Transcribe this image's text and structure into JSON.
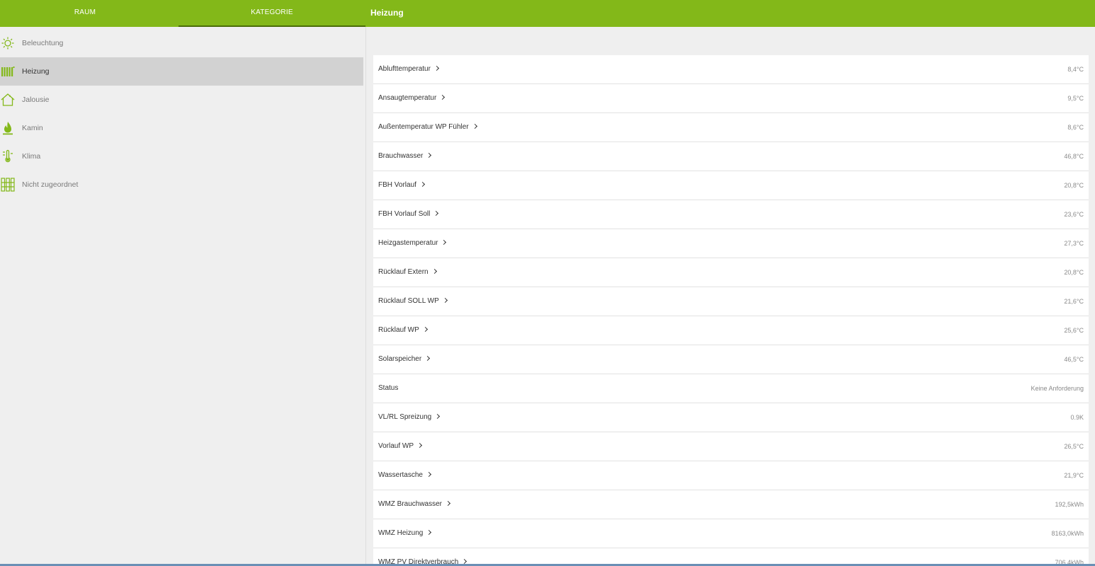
{
  "header": {
    "tabs": [
      {
        "label": "RAUM"
      },
      {
        "label": "KATEGORIE"
      }
    ],
    "title": "Heizung",
    "accent_color": "#83b819"
  },
  "sidebar": {
    "items": [
      {
        "label": "Beleuchtung",
        "icon": "lightbulb-icon"
      },
      {
        "label": "Heizung",
        "icon": "radiator-icon",
        "active": true
      },
      {
        "label": "Jalousie",
        "icon": "house-icon"
      },
      {
        "label": "Kamin",
        "icon": "flame-icon"
      },
      {
        "label": "Klima",
        "icon": "thermometer-icon"
      },
      {
        "label": "Nicht zugeordnet",
        "icon": "grid-icon"
      }
    ]
  },
  "list": {
    "rows": [
      {
        "name": "Ablufttemperatur",
        "value": "8,4°C",
        "chevron": true
      },
      {
        "name": "Ansaugtemperatur",
        "value": "9,5°C",
        "chevron": true
      },
      {
        "name": "Außentemperatur WP Fühler",
        "value": "8,6°C",
        "chevron": true
      },
      {
        "name": "Brauchwasser",
        "value": "46,8°C",
        "chevron": true
      },
      {
        "name": "FBH Vorlauf",
        "value": "20,8°C",
        "chevron": true
      },
      {
        "name": "FBH Vorlauf Soll",
        "value": "23,6°C",
        "chevron": true
      },
      {
        "name": "Heizgastemperatur",
        "value": "27,3°C",
        "chevron": true
      },
      {
        "name": "Rücklauf Extern",
        "value": "20,8°C",
        "chevron": true
      },
      {
        "name": "Rücklauf SOLL WP",
        "value": "21,6°C",
        "chevron": true
      },
      {
        "name": "Rücklauf WP",
        "value": "25,6°C",
        "chevron": true
      },
      {
        "name": "Solarspeicher",
        "value": "46,5°C",
        "chevron": true
      },
      {
        "name": "Status",
        "value": "Keine Anforderung",
        "chevron": false
      },
      {
        "name": "VL/RL Spreizung",
        "value": "0.9K",
        "chevron": true
      },
      {
        "name": "Vorlauf WP",
        "value": "26,5°C",
        "chevron": true
      },
      {
        "name": "Wassertasche",
        "value": "21,9°C",
        "chevron": true
      },
      {
        "name": "WMZ Brauchwasser",
        "value": "192,5kWh",
        "chevron": true
      },
      {
        "name": "WMZ Heizung",
        "value": "8163,0kWh",
        "chevron": true
      },
      {
        "name": "WMZ PV Direktverbrauch",
        "value": "706,4kWh",
        "chevron": true
      }
    ]
  }
}
